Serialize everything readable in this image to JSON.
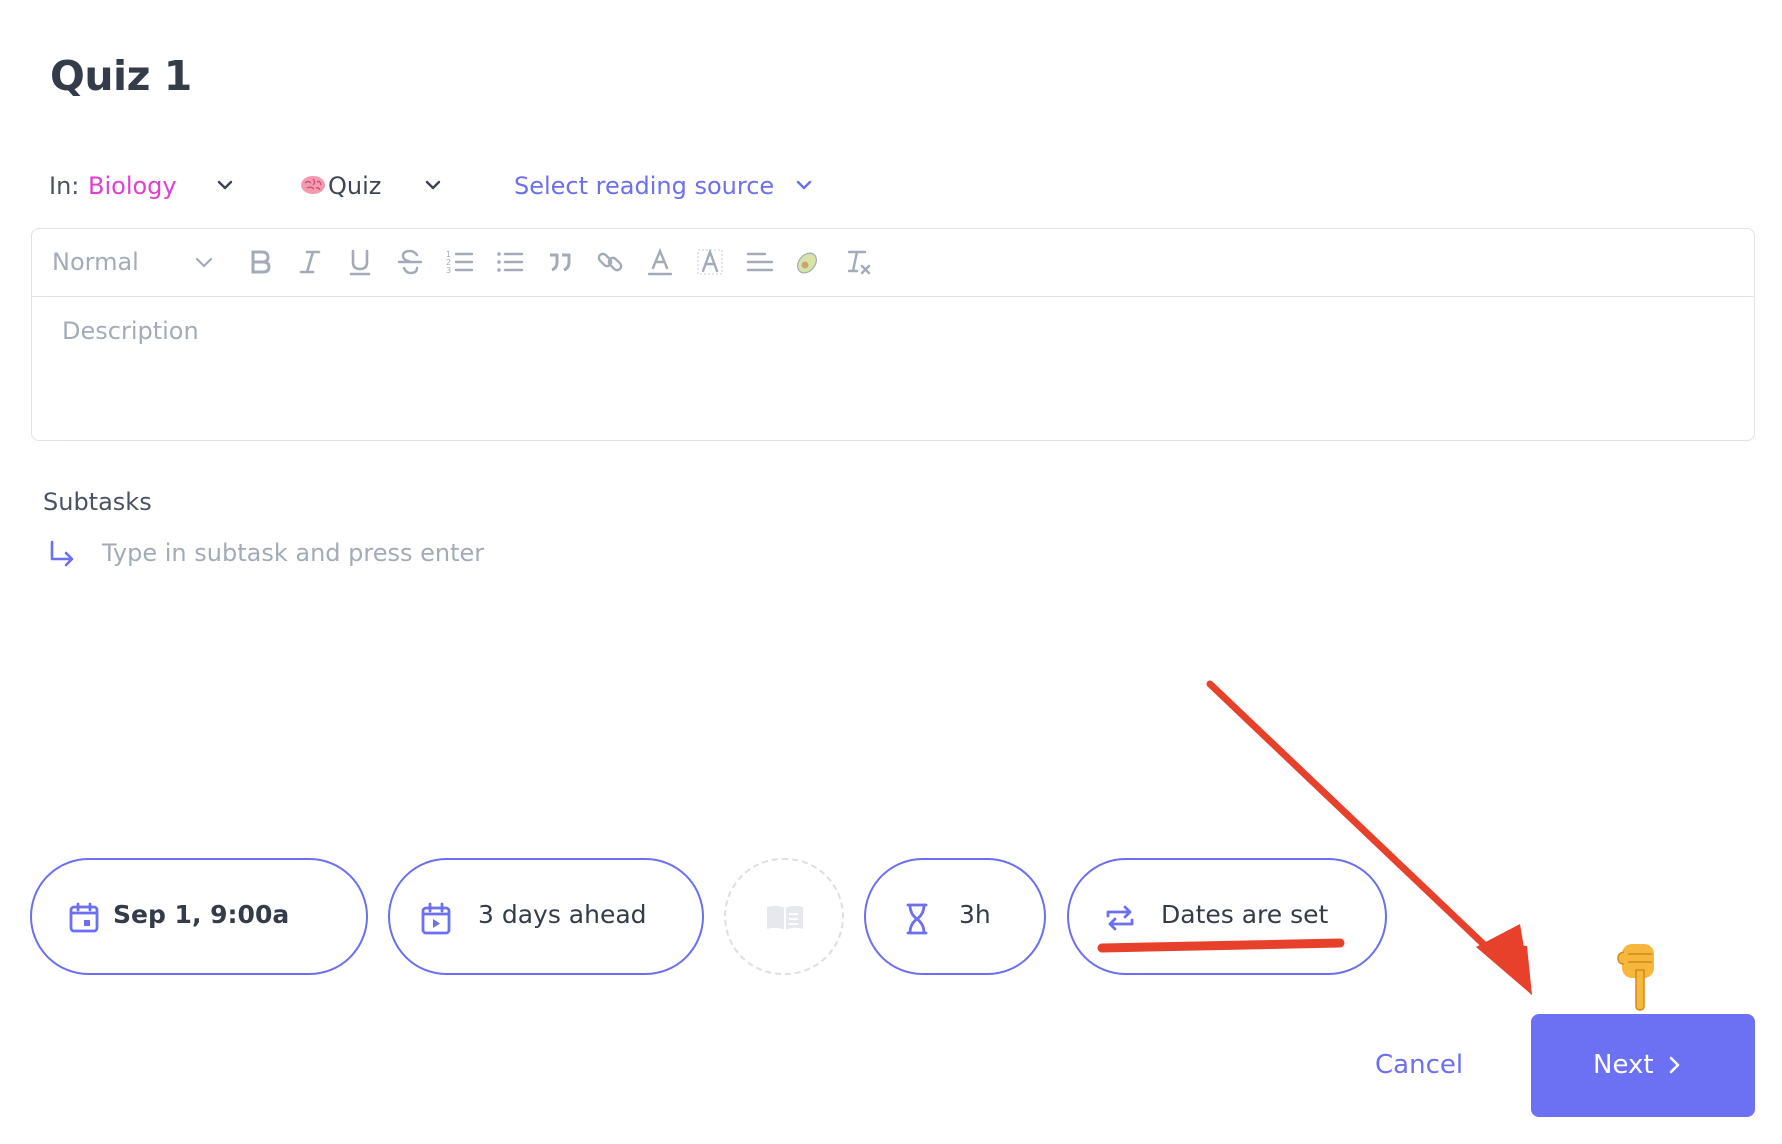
{
  "page": {
    "title": "Quiz 1"
  },
  "meta": {
    "in_label": "In:",
    "course": "Biology",
    "type": "Quiz",
    "reading_source": "Select reading source"
  },
  "editor": {
    "format": "Normal",
    "placeholder": "Description"
  },
  "subtasks": {
    "label": "Subtasks",
    "placeholder": "Type in subtask and press enter"
  },
  "pills": {
    "date": "Sep 1, 9:00a",
    "plan_ahead": "3 days ahead",
    "duration": "3h",
    "repeat": "Dates are set"
  },
  "footer": {
    "cancel": "Cancel",
    "next": "Next"
  },
  "colors": {
    "accent": "#6c70f2",
    "course": "#e040d0",
    "annotation": "#e8412b",
    "placeholder": "#a4abb8"
  }
}
